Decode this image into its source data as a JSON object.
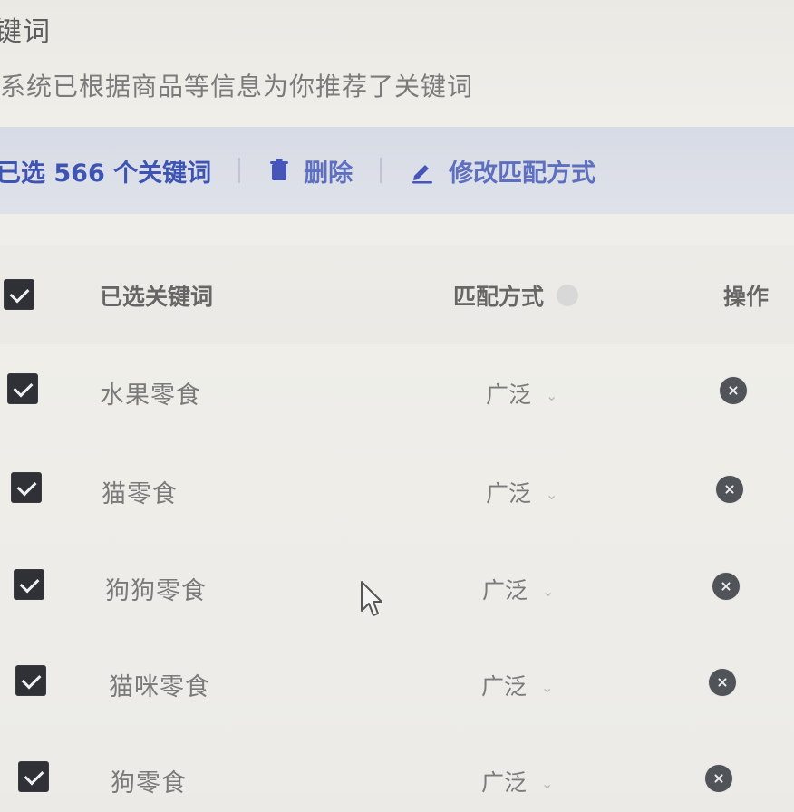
{
  "header": {
    "title": "键词",
    "subtitle": "系统已根据商品等信息为你推荐了关键词"
  },
  "toolbar": {
    "selected_text": "已选 566 个关键词",
    "delete_label": "删除",
    "edit_match_label": "修改匹配方式",
    "accent_color": "#3e54b3"
  },
  "table": {
    "headers": {
      "selected_keywords": "已选关键词",
      "match_type": "匹配方式",
      "action": "操作"
    },
    "rows": [
      {
        "keyword": "水果零食",
        "match": "广泛"
      },
      {
        "keyword": "猫零食",
        "match": "广泛"
      },
      {
        "keyword": "狗狗零食",
        "match": "广泛"
      },
      {
        "keyword": "猫咪零食",
        "match": "广泛"
      },
      {
        "keyword": "狗零食",
        "match": "广泛"
      }
    ]
  },
  "icons": {
    "trash": "trash-icon",
    "edit": "pencil-icon",
    "chevron": "chevron-down-icon",
    "close": "close-icon",
    "cursor": "mouse-cursor-icon"
  }
}
